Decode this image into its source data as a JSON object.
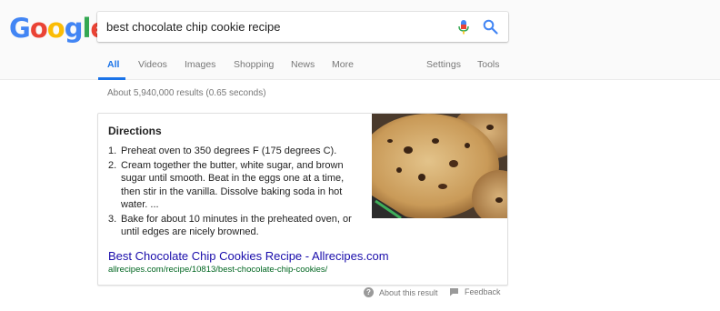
{
  "logo": {
    "letters": [
      {
        "char": "G",
        "color": "#4285F4"
      },
      {
        "char": "o",
        "color": "#EA4335"
      },
      {
        "char": "o",
        "color": "#FBBC05"
      },
      {
        "char": "g",
        "color": "#4285F4"
      },
      {
        "char": "l",
        "color": "#34A853"
      },
      {
        "char": "e",
        "color": "#EA4335"
      }
    ]
  },
  "search": {
    "query": "best chocolate chip cookie recipe",
    "mic_icon": "microphone-icon",
    "search_icon": "search-icon"
  },
  "tabs": [
    {
      "label": "All",
      "active": true
    },
    {
      "label": "Videos"
    },
    {
      "label": "Images"
    },
    {
      "label": "Shopping"
    },
    {
      "label": "News"
    },
    {
      "label": "More"
    },
    {
      "label": "Settings"
    },
    {
      "label": "Tools"
    }
  ],
  "stats": "About 5,940,000 results (0.65 seconds)",
  "snippet": {
    "title": "Directions",
    "steps": [
      {
        "num": "1.",
        "text": "Preheat oven to 350 degrees F (175 degrees C)."
      },
      {
        "num": "2.",
        "text": "Cream together the butter, white sugar, and brown sugar until smooth. Beat in the eggs one at a time, then stir in the vanilla. Dissolve baking soda in hot water. ..."
      },
      {
        "num": "3.",
        "text": "Bake for about 10 minutes in the preheated oven, or until edges are nicely browned."
      }
    ],
    "link_text": "Best Chocolate Chip Cookies Recipe - Allrecipes.com",
    "url": "allrecipes.com/recipe/10813/best-chocolate-chip-cookies/"
  },
  "footer": {
    "about": "About this result",
    "feedback": "Feedback"
  },
  "colors": {
    "accent": "#1a73e8",
    "link": "#1a0dab",
    "url": "#006621"
  }
}
